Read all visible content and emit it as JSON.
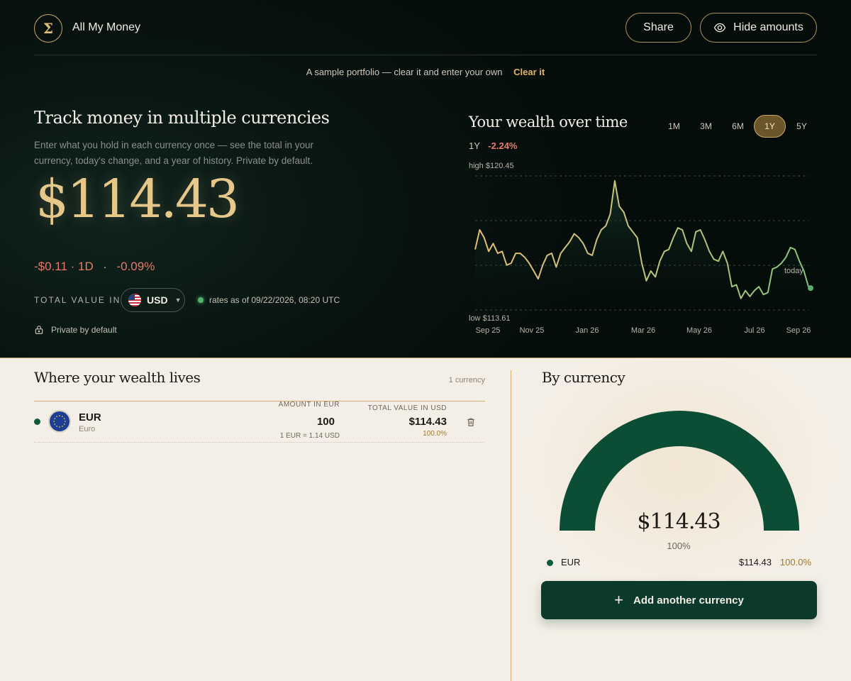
{
  "header": {
    "logo_glyph": "Σ",
    "app_title": "All My Money",
    "share_label": "Share",
    "hide_label": "Hide amounts"
  },
  "banner": {
    "text": "A sample portfolio — clear it and enter your own",
    "clear_label": "Clear it"
  },
  "hero": {
    "title": "Track money in multiple currencies",
    "subtitle": "Enter what you hold in each currency once — see the total in your currency, today's change, and a year of history. Private by default.",
    "total": "$114.43",
    "change_abs": "-$0.11 · 1D",
    "change_sep": "·",
    "change_pct": "-0.09%",
    "total_in_label": "TOTAL VALUE IN",
    "currency_code": "USD",
    "rates_text": "rates as of 09/22/2026, 08:20 UTC",
    "private_label": "Private by default"
  },
  "chart": {
    "title": "Your wealth over time",
    "ranges": [
      "1M",
      "3M",
      "6M",
      "1Y",
      "5Y"
    ],
    "active_range": "1Y",
    "period_label": "1Y",
    "period_change": "-2.24%",
    "high_label": "high $120.45",
    "low_label": "low $113.61",
    "today_label": "today",
    "colors": {
      "gold": "#d9b56e",
      "green": "#8fc27a",
      "accent_dot": "#57b06e"
    }
  },
  "chart_data": {
    "type": "line",
    "title": "Your wealth over time",
    "xlabel": "",
    "ylabel": "",
    "x_ticks": [
      "Sep 25",
      "Nov 25",
      "Jan 26",
      "Mar 26",
      "May 26",
      "Jul 26",
      "Sep 26"
    ],
    "ylim": [
      113.61,
      120.45
    ],
    "grid": true,
    "series": [
      {
        "values": [
          116.7,
          117.7,
          117.3,
          116.6,
          117.0,
          116.5,
          116.6,
          115.9,
          116.0,
          116.5,
          116.5,
          116.3,
          116.0,
          115.6,
          115.2,
          115.9,
          116.4,
          116.5,
          115.8,
          116.5,
          116.8,
          117.1,
          117.5,
          117.3,
          117.0,
          116.5,
          116.4,
          117.2,
          117.7,
          117.9,
          118.5,
          120.2,
          118.9,
          118.6,
          117.9,
          117.6,
          117.3,
          116.0,
          115.1,
          115.6,
          115.3,
          116.1,
          116.6,
          116.7,
          117.3,
          117.8,
          117.7,
          117.0,
          116.6,
          117.6,
          117.7,
          117.2,
          116.6,
          116.2,
          116.1,
          116.6,
          116.0,
          114.8,
          114.9,
          114.2,
          114.6,
          114.3,
          114.6,
          114.8,
          114.4,
          114.5,
          115.7,
          115.8,
          116.0,
          116.3,
          116.8,
          116.7,
          116.1,
          115.6,
          114.8
        ]
      }
    ]
  },
  "holdings": {
    "title": "Where your wealth lives",
    "count_label": "1 currency",
    "col_amount": "AMOUNT IN EUR",
    "col_total": "TOTAL VALUE IN USD",
    "rows": [
      {
        "code": "EUR",
        "name": "Euro",
        "amount": "100",
        "rate": "1 EUR = 1.14 USD",
        "total": "$114.43",
        "pct": "100.0%"
      }
    ]
  },
  "by_currency": {
    "title": "By currency",
    "total": "$114.43",
    "total_pct": "100%",
    "legend": [
      {
        "code": "EUR",
        "value": "$114.43",
        "pct": "100.0%"
      }
    ],
    "share_fraction": 1.0,
    "gauge_color": "#0b4d35",
    "add_label": "Add another currency"
  }
}
